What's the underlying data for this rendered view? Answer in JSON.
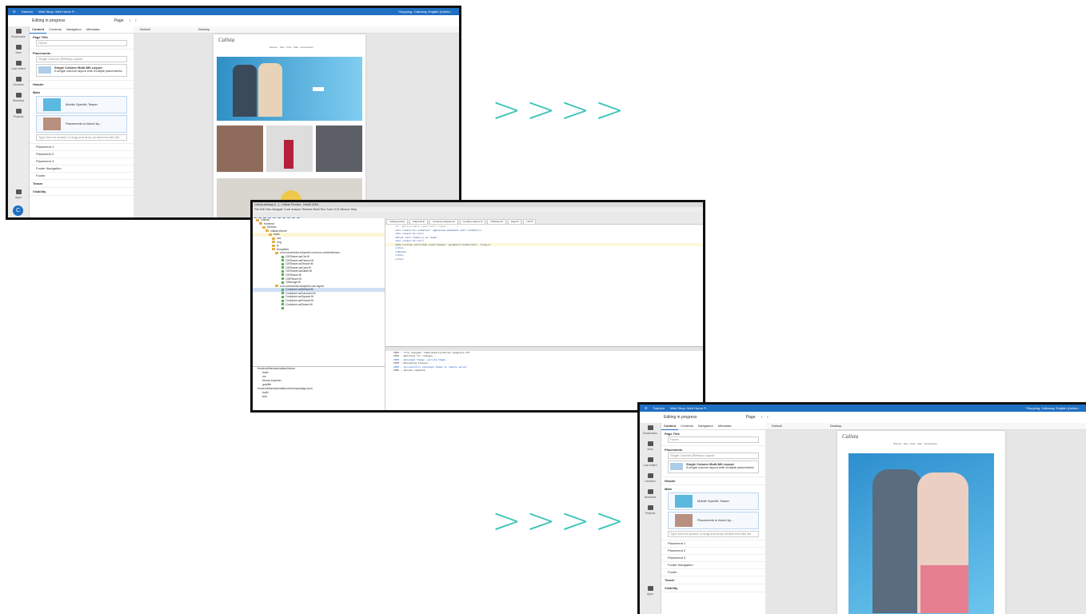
{
  "arrows": ">>>>",
  "screen1": {
    "topbar": {
      "tab": "Fashion",
      "page_title": "Web Shop: Web Home P...",
      "user": "Shopping, Calloway, English (United..."
    },
    "toolbar": {
      "title": "Editing in progress",
      "page_btn": "Page"
    },
    "nav": [
      "Bookmarks",
      "New",
      "Last edited",
      "Libraries",
      "Workflow",
      "Projects"
    ],
    "apps": "Apps",
    "tabs": [
      "Content",
      "Contexts",
      "Navigation",
      "Metadata"
    ],
    "sections": {
      "page_title": "Page Title",
      "page_title_value": "Home",
      "placements": "Placements",
      "layout_label": "Single Column (Reflow) Layout",
      "layout_name": "Single Column Multi-Mit Layout",
      "layout_desc": "A single column layout with multiple placements.",
      "header": "Header",
      "main": "Main"
    },
    "items": [
      {
        "label": "Mobile Specific Teaser"
      },
      {
        "label": "Placements in linked by..."
      }
    ],
    "drop_hint": "Type here to search or drag and drop content into this list",
    "placement_list": [
      "Placement 1",
      "Placement 2",
      "Placement 3",
      "Footer Navigation",
      "Footer"
    ],
    "teaser": "Teaser",
    "visibility": "Visibility",
    "canvas": {
      "device": "Default",
      "status": "Desktop"
    },
    "site": {
      "brand": "Calista",
      "nav": [
        "Women",
        "Men",
        "Kids",
        "Sale",
        "Accessories"
      ]
    }
  },
  "screen2": {
    "title": "Calista-webapp [/...] - Calista Preview - IntelliJ IDEA",
    "menu": [
      "File",
      "Edit",
      "View",
      "Navigate",
      "Code",
      "Analyze",
      "Refactor",
      "Build",
      "Run",
      "Tools",
      "VCS",
      "Window",
      "Help"
    ],
    "tree": [
      "Calista",
      "frontend",
      "themes",
      "calista-theme",
      "build",
      "css",
      "img",
      "js",
      "templates",
      "com.coremedia.blueprint.common.contentbeans",
      "CMTeaser.asCta.ftl",
      "CMTeaser.asPicture.ftl",
      "CMTeaser.asTeaser.ftl",
      "CMTeaser.asCard.ftl",
      "CMTeaser.asSlider.ftl",
      "CMTeaser.ftl",
      "CMPicture.ftl",
      "CMImage.ftl",
      "com.coremedia.blueprint.cae.layout",
      "Container.asDefault.ftl",
      "Container.asCarousel.ftl",
      "Container.asSquare.ftl",
      "Container.asPortrait.ftl",
      "Container.asTeaser.ftl"
    ],
    "editor_tabs": [
      "Calista-preview",
      "PageGrid.ftl",
      "Container.asSquare.ftl",
      "Container.asHero.ftl",
      "CMTeaser.ftl",
      "Page.ftl",
      "Link.ftl"
    ],
    "code": [
      "<#-- @ftlvariable name=\"self\" type=\"...\" -->",
      "<div class=\"cm-container\" <@preview.metadata self.content/>>",
      "  <div class=\"cm-row\">",
      "    <#list self.items![] as item>",
      "      <div class=\"cm-col\">",
      "        <@cm.include self=item view=\"teaser\" params={\"renderLink\": true}/>",
      "      </div>",
      "    </#list>",
      "  </div>",
      "</div>"
    ],
    "lower": [
      "frontend/themes/calista-theme",
      "build",
      "src",
      "theme-importer",
      "gulpfile",
      "frontend/themes/calista-theme/package.json",
      "build",
      "test"
    ],
    "console": [
      "INFO  - file changed: templates/Container.asSquare.ftl",
      "INFO  - Watching for changes...",
      "INFO  - Uploaded theme: calista-theme",
      "INFO  - Reloading browser...",
      "INFO  - Successfully uploaded theme to remote server",
      "INFO  - Upload complete"
    ]
  },
  "screen3": {
    "topbar": {
      "tab": "Fashion",
      "page_title": "Web Shop: Web Home P...",
      "user": "Shopping, Calloway, English (United..."
    },
    "toolbar": {
      "title": "Editing in progress",
      "page_btn": "Page"
    },
    "nav": [
      "Bookmarks",
      "New",
      "Last edited",
      "Libraries",
      "Workflow",
      "Projects"
    ],
    "apps": "Apps",
    "tabs": [
      "Content",
      "Contexts",
      "Navigation",
      "Metadata"
    ],
    "sections": {
      "page_title": "Page Title",
      "page_title_value": "Home",
      "placements": "Placements",
      "layout_label": "Single Column (Reflow) Layout",
      "layout_name": "Single Column Multi-Mit Layout",
      "layout_desc": "A single column layout with multiple placements.",
      "header": "Header",
      "main": "Main"
    },
    "items": [
      {
        "label": "Mobile Specific Teaser"
      },
      {
        "label": "Placements in linked by..."
      }
    ],
    "drop_hint": "Type here to search or drag and drop content into this list",
    "placement_list": [
      "Placement 1",
      "Placement 2",
      "Placement 3",
      "Footer Navigation",
      "Footer"
    ],
    "teaser": "Teaser",
    "visibility": "Visibility",
    "canvas": {
      "device": "Default",
      "status": "Desktop"
    },
    "site": {
      "brand": "Calista",
      "nav": [
        "Women",
        "Men",
        "Kids",
        "Sale",
        "Accessories"
      ]
    }
  }
}
